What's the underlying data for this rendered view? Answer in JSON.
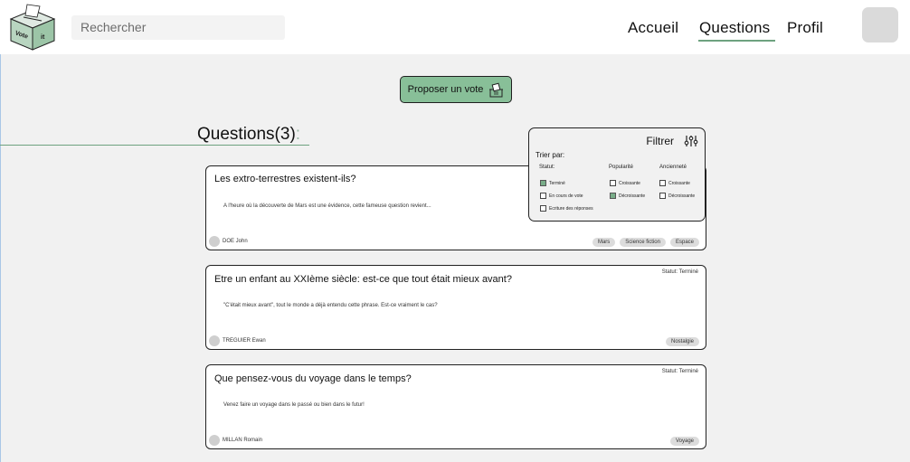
{
  "logo": {
    "text_left": "Vote",
    "text_right": "it"
  },
  "search": {
    "placeholder": "Rechercher"
  },
  "nav": {
    "home": "Accueil",
    "questions": "Questions",
    "profile": "Profil"
  },
  "propose_button": "Proposer un vote",
  "questions_heading": {
    "label": "Questions(3)",
    "suffix": ":"
  },
  "filter": {
    "title": "Filtrer",
    "sort_by": "Trier par:",
    "columns": {
      "status": "Statut:",
      "popularity": "Popularité",
      "age": "Ancienneté"
    },
    "status_options": [
      {
        "label": "Terminé",
        "checked": true
      },
      {
        "label": "En cours de vote",
        "checked": false
      },
      {
        "label": "Ecriture des réponses",
        "checked": false
      }
    ],
    "popularity_options": [
      {
        "label": "Croissante",
        "checked": false
      },
      {
        "label": "Décroissante",
        "checked": true
      }
    ],
    "age_options": [
      {
        "label": "Croissante",
        "checked": false
      },
      {
        "label": "Décroissante",
        "checked": false
      }
    ]
  },
  "questions": [
    {
      "title": "Les extro-terrestres existent-ils?",
      "excerpt": "A l'heure où la découverte de Mars est une évidence, cette fameuse question revient...",
      "author": "DOE John",
      "status": "",
      "tags": [
        "Mars",
        "Science fiction",
        "Espace"
      ]
    },
    {
      "title": "Etre un enfant au XXIème siècle: est-ce que tout était mieux avant?",
      "excerpt": "\"C'était mieux avant\", tout le monde a déjà entendu cette phrase. Est-ce vraiment le cas?",
      "author": "TREGUIER Ewan",
      "status": "Statut: Terminé",
      "tags": [
        "Nostalgie"
      ]
    },
    {
      "title": "Que pensez-vous du voyage dans le temps?",
      "excerpt": "Venez faire un voyage dans le passé ou bien dans le futur!",
      "author": "MILLAN Romain",
      "status": "Statut: Terminé",
      "tags": [
        "Voyage"
      ]
    }
  ],
  "colors": {
    "accent": "#88bf98",
    "accent_dark": "#6da27f",
    "checked": "#79ad89"
  }
}
